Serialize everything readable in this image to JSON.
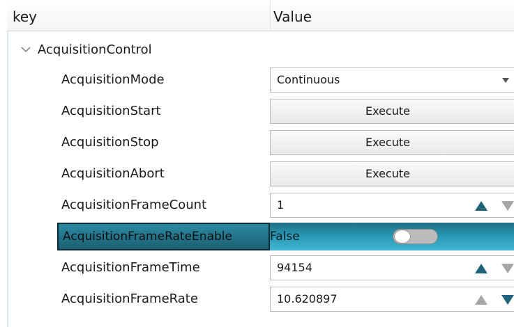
{
  "header": {
    "key_label": "key",
    "value_label": "Value"
  },
  "group": {
    "label": "AcquisitionControl",
    "icon": "chevron-down-icon"
  },
  "rows": [
    {
      "name": "AcquisitionMode",
      "value": "Continuous",
      "type": "combo"
    },
    {
      "name": "AcquisitionStart",
      "value": "Execute",
      "type": "button"
    },
    {
      "name": "AcquisitionStop",
      "value": "Execute",
      "type": "button"
    },
    {
      "name": "AcquisitionAbort",
      "value": "Execute",
      "type": "button"
    },
    {
      "name": "AcquisitionFrameCount",
      "value": "1",
      "type": "spin"
    },
    {
      "name": "AcquisitionFrameRateEnable",
      "value": "False",
      "type": "toggle",
      "selected": true,
      "toggle_on": false
    },
    {
      "name": "AcquisitionFrameTime",
      "value": "94154",
      "type": "spin"
    },
    {
      "name": "AcquisitionFrameRate",
      "value": "10.620897",
      "type": "spin"
    }
  ],
  "colors": {
    "selection_start": "#1e6f85",
    "selection_end": "#41b7d2",
    "spin_arrow": "#1f6478",
    "spin_arrow_disabled": "#a6a6a6"
  }
}
